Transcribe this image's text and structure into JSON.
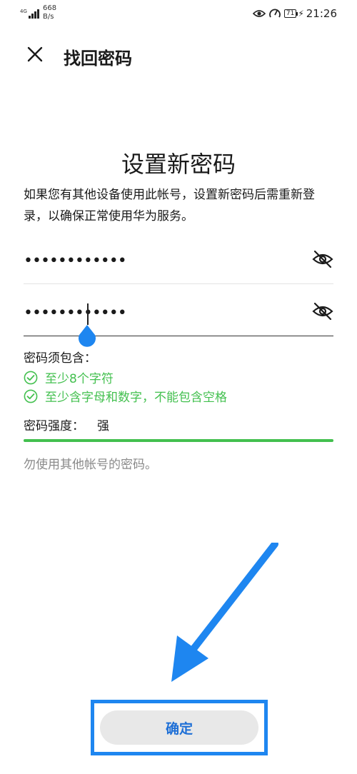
{
  "status_bar": {
    "network": "4G",
    "net_speed_value": "668",
    "net_speed_unit": "B/s",
    "battery": "71",
    "time": "21:26"
  },
  "header": {
    "title": "找回密码"
  },
  "main": {
    "heading": "设置新密码",
    "description": "如果您有其他设备使用此帐号，设置新密码后需重新登录，以确保正常使用华为服务。",
    "password_masked": "••••••••••••",
    "confirm_password_masked": "••••••••••••",
    "requirements_title": "密码须包含：",
    "requirements": [
      "至少8个字符",
      "至少含字母和数字，不能包含空格"
    ],
    "strength_label": "密码强度：",
    "strength_value": "强",
    "strength_level": 1.0,
    "hint": "勿使用其他帐号的密码。",
    "confirm_label": "确定"
  },
  "colors": {
    "accent_blue": "#1e86f0",
    "success_green": "#43c04f"
  }
}
